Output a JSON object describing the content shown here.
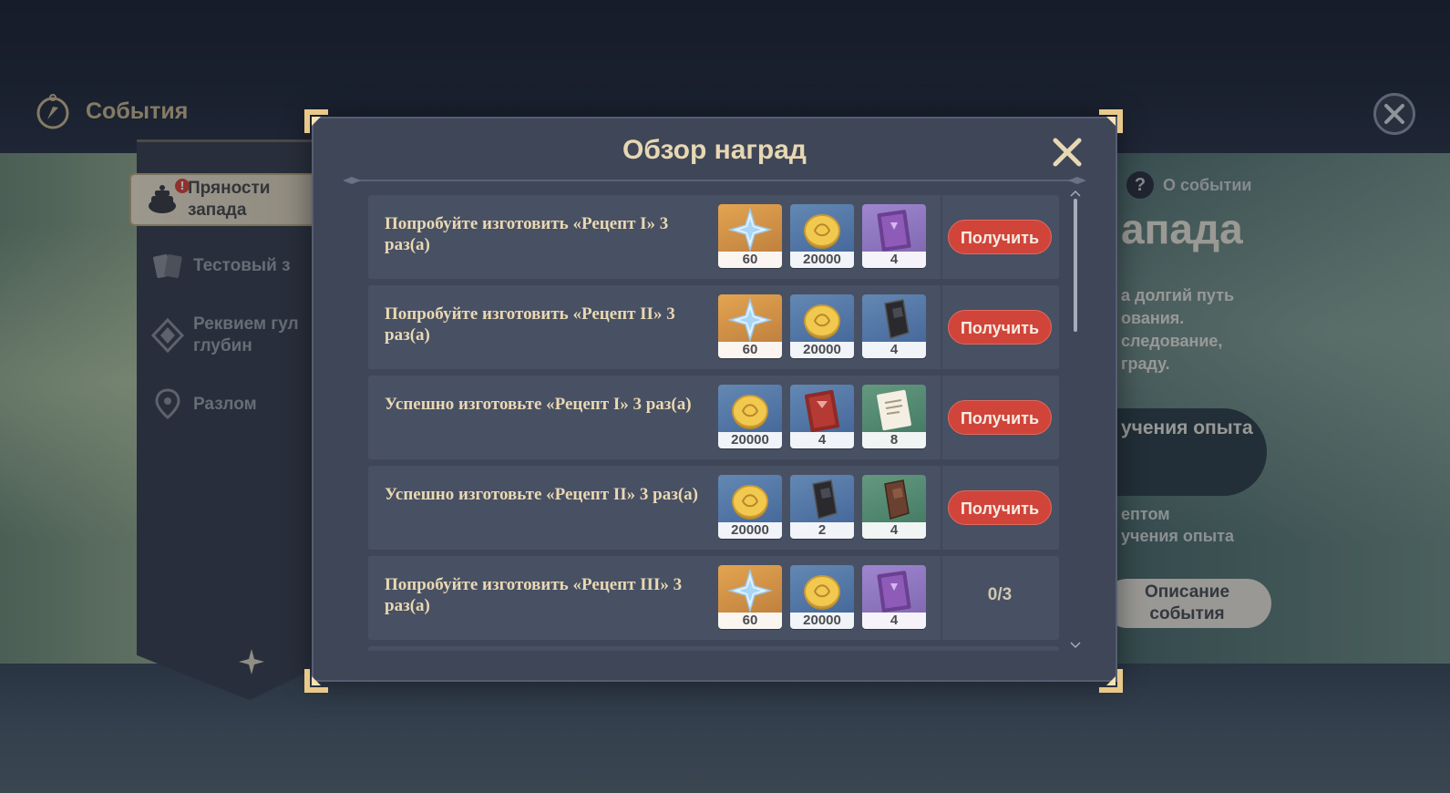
{
  "header": {
    "title": "События"
  },
  "sidebar": {
    "items": [
      {
        "label_line1": "Пряности",
        "label_line2": "запада",
        "badge": "!"
      },
      {
        "label": "Тестовый з"
      },
      {
        "label_line1": "Реквием гул",
        "label_line2": "глубин"
      },
      {
        "label": "Разлом"
      }
    ]
  },
  "background_panel": {
    "about": "О событии",
    "title": "апада",
    "desc_lines": [
      "а долгий путь",
      "ования.",
      "следование,",
      "граду."
    ],
    "exp_button": "учения опыта",
    "sub_lines": [
      "ептом",
      "учения опыта"
    ],
    "description_button_line1": "Описание",
    "description_button_line2": "события"
  },
  "modal": {
    "title": "Обзор наград",
    "claim_label": "Получить",
    "rows": [
      {
        "text": "Попробуйте изготовить «Рецепт I» 3 раз(а)",
        "rewards": [
          {
            "icon": "primogem-icon",
            "bg": "gold",
            "count": "60"
          },
          {
            "icon": "mora-coin-icon",
            "bg": "blue",
            "count": "20000"
          },
          {
            "icon": "purple-book-icon",
            "bg": "purple",
            "count": "4"
          }
        ],
        "status": "claim"
      },
      {
        "text": "Попробуйте изготовить «Рецепт II» 3 раз(а)",
        "rewards": [
          {
            "icon": "primogem-icon",
            "bg": "gold",
            "count": "60"
          },
          {
            "icon": "mora-coin-icon",
            "bg": "blue",
            "count": "20000"
          },
          {
            "icon": "dark-ore-icon",
            "bg": "blue",
            "count": "4"
          }
        ],
        "status": "claim"
      },
      {
        "text": "Успешно изготовьте «Рецепт I» 3 раз(а)",
        "rewards": [
          {
            "icon": "mora-coin-icon",
            "bg": "blue",
            "count": "20000"
          },
          {
            "icon": "red-book-icon",
            "bg": "blue",
            "count": "4"
          },
          {
            "icon": "scroll-note-icon",
            "bg": "green",
            "count": "8"
          }
        ],
        "status": "claim"
      },
      {
        "text": "Успешно изготовьте «Рецепт II» 3 раз(а)",
        "rewards": [
          {
            "icon": "mora-coin-icon",
            "bg": "blue",
            "count": "20000"
          },
          {
            "icon": "dark-ore-icon",
            "bg": "blue",
            "count": "2"
          },
          {
            "icon": "brown-ore-icon",
            "bg": "green",
            "count": "4"
          }
        ],
        "status": "claim"
      },
      {
        "text": "Попробуйте изготовить «Рецепт III» 3 раз(а)",
        "rewards": [
          {
            "icon": "primogem-icon",
            "bg": "gold",
            "count": "60"
          },
          {
            "icon": "mora-coin-icon",
            "bg": "blue",
            "count": "20000"
          },
          {
            "icon": "purple-book-icon",
            "bg": "purple",
            "count": "4"
          }
        ],
        "status": "progress",
        "progress": "0/3"
      }
    ]
  },
  "colors": {
    "accent_gold": "#e7d8b3",
    "claim_red": "#d0443a",
    "modal_bg": "#3f4658",
    "row_bg": "#485063"
  }
}
